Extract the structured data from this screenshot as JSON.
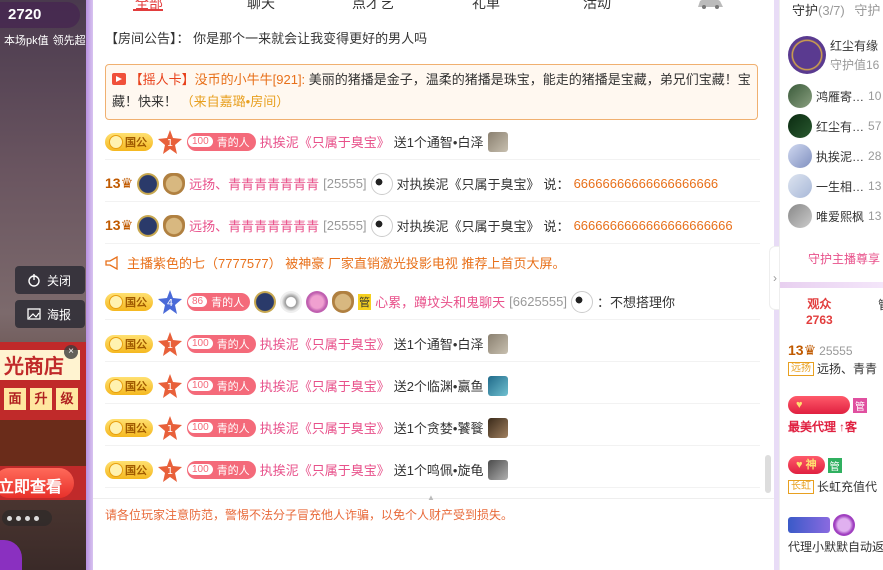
{
  "left": {
    "score": "2720",
    "pk_label": "本场pk值",
    "pk_lead": "领先超",
    "close_label": "关闭",
    "poster_label": "海报",
    "shop_title": "光商店",
    "shop_sub": [
      "面",
      "升",
      "级"
    ],
    "shop_button": "立即查看"
  },
  "tabs": [
    "全部",
    "聊天",
    "点才艺",
    "礼单",
    "活动"
  ],
  "chat": {
    "announcement_label": "【房间公告】：",
    "announcement_text": "你是那个一来就会让我变得更好的男人吗",
    "notice_tag": "【摇人卡】",
    "notice_user": "没币的小牛牛[921]:",
    "notice_text": "美丽的猪播是金子，温柔的猪播是珠宝，能走的猪播是宝藏，弟兄们宝藏！宝藏！快来！",
    "notice_from": "（来自嘉璐•房间）",
    "messages": [
      {
        "type": "gift",
        "gong": "国公",
        "star": "1",
        "level": "100",
        "level_label": "青的人",
        "user": "执挨泥《只属于臭宝》",
        "action": "送1个通智•白泽"
      },
      {
        "type": "chat",
        "lv": "13",
        "user": "远扬、青青青青青青青",
        "id": "[25555]",
        "target": "对执挨泥《只属于臭宝》",
        "say": "说：",
        "text": "66666666666666666666"
      },
      {
        "type": "chat",
        "lv": "13",
        "user": "远扬、青青青青青青青",
        "id": "[25555]",
        "target": "对执挨泥《只属于臭宝》",
        "say": "说：",
        "text": "6666666666666666666666"
      },
      {
        "type": "gift",
        "gong": "国公",
        "star": "4",
        "level": "86",
        "level_label": "青的人",
        "user": "心累，蹲坟头和鬼聊天",
        "id": "[6625555]",
        "action": "：不想搭理你",
        "mgr": "管"
      },
      {
        "type": "gift",
        "gong": "国公",
        "star": "1",
        "level": "100",
        "level_label": "青的人",
        "user": "执挨泥《只属于臭宝》",
        "action": "送1个通智•白泽"
      },
      {
        "type": "gift",
        "gong": "国公",
        "star": "1",
        "level": "100",
        "level_label": "青的人",
        "user": "执挨泥《只属于臭宝》",
        "action": "送2个临渊•赢鱼"
      },
      {
        "type": "gift",
        "gong": "国公",
        "star": "1",
        "level": "100",
        "level_label": "青的人",
        "user": "执挨泥《只属于臭宝》",
        "action": "送1个贪婪•饕餮"
      },
      {
        "type": "gift",
        "gong": "国公",
        "star": "1",
        "level": "100",
        "level_label": "青的人",
        "user": "执挨泥《只属于臭宝》",
        "action": "送1个鸣佩•旋龟"
      }
    ],
    "system_line": "主播紫色的七（7777577） 被神豪 厂家直销激光投影电视 推荐上首页大屏。",
    "bottom_tip": "请各位玩家注意防范，警惕不法分子冒充他人诈骗，以免个人财产受到损失。"
  },
  "right": {
    "guard_tab": "守护",
    "guard_count": "(3/7)",
    "guard_tab2": "守护",
    "top_guard_name": "红尘有缘",
    "top_guard_value": "守护值16",
    "guards": [
      {
        "name": "鸿雁寄…",
        "value": "10"
      },
      {
        "name": "红尘有…",
        "value": "57"
      },
      {
        "name": "执挨泥…",
        "value": "28"
      },
      {
        "name": "一生相…",
        "value": "13"
      },
      {
        "name": "唯爱熙枫",
        "value": "13"
      }
    ],
    "guard_note": "守护主播尊享",
    "audience_label": "观众",
    "audience_count": "2763",
    "mgr_tab": "管",
    "aud_lv": "13",
    "aud_id": "25555",
    "aud_badge": "远扬",
    "aud_name": "远扬、青青",
    "best_agent": "最美代理",
    "best_agent_suffix": "↑客",
    "god_label": "神",
    "long_badge": "长虹",
    "long_text": "长虹充值代",
    "agent_text": "代理小默默自动返"
  }
}
